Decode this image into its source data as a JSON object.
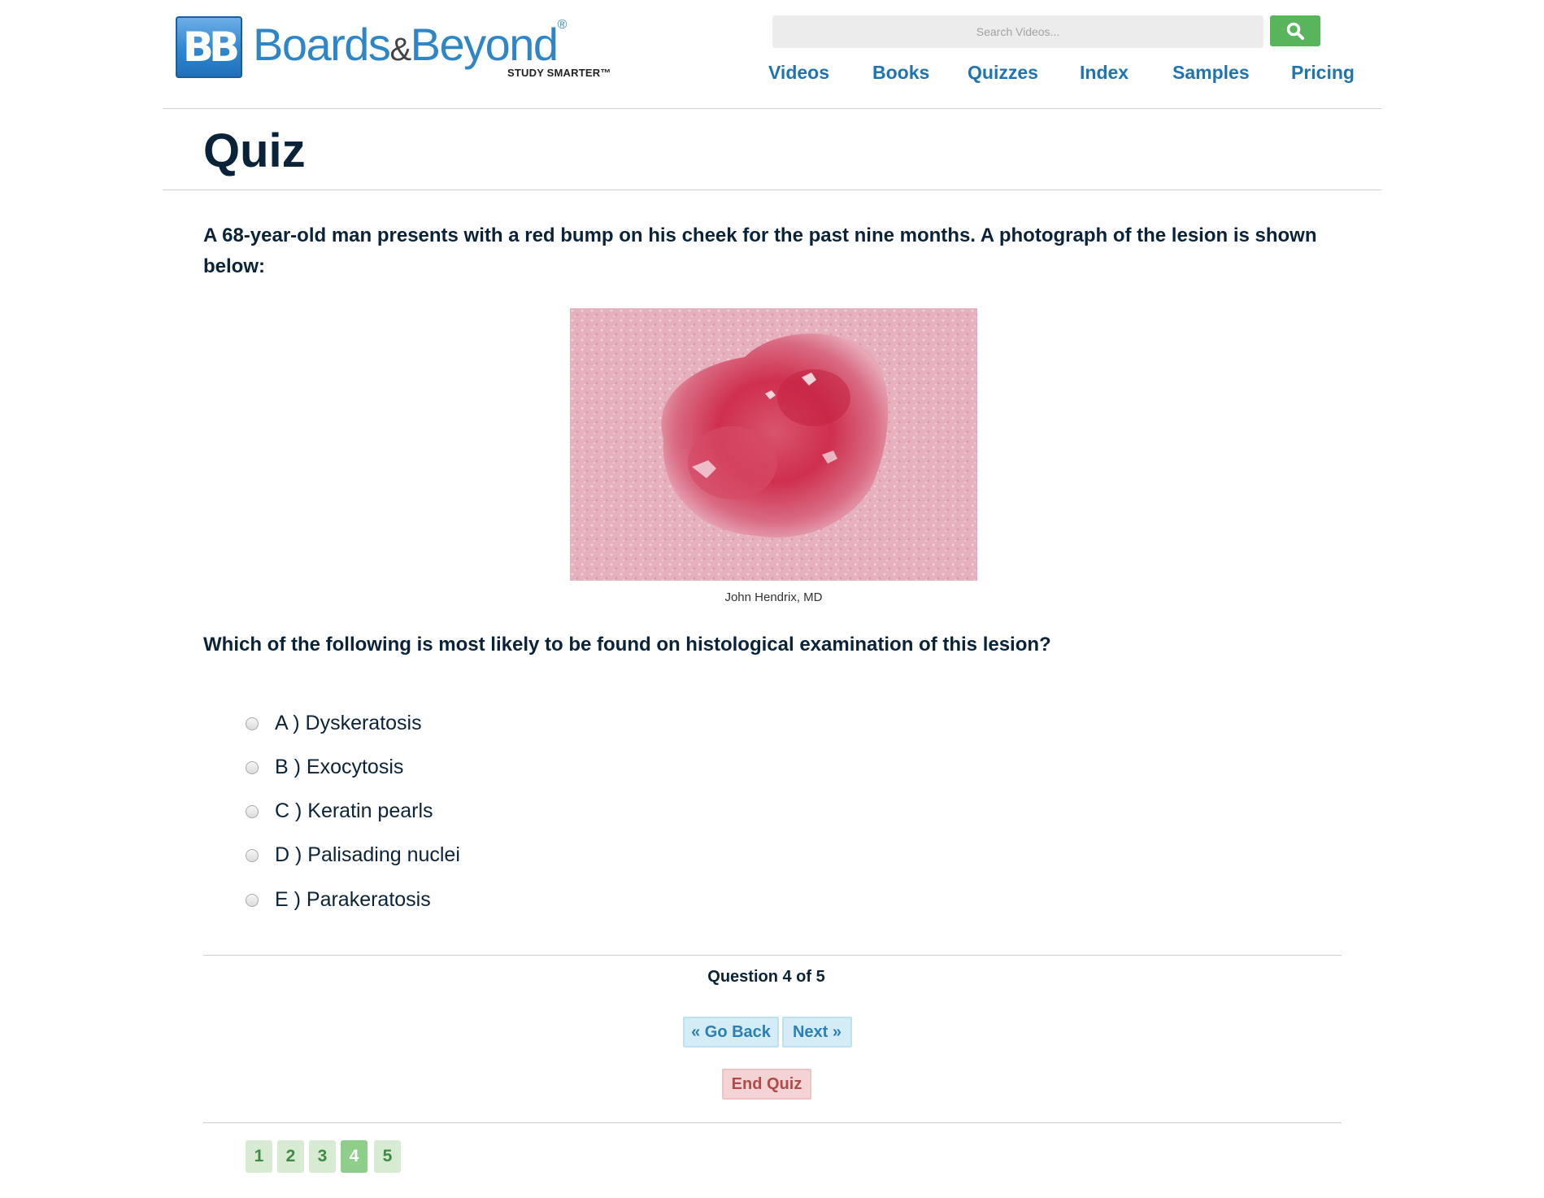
{
  "brand": {
    "badge": "BB",
    "name_part1": "Boards",
    "name_amp": "&",
    "name_part2": "Beyond",
    "registered": "®",
    "tagline": "STUDY SMARTER™"
  },
  "search": {
    "placeholder": "Search Videos...",
    "icon": "search-icon",
    "button_color": "#59b55c"
  },
  "nav": {
    "items": [
      "Videos",
      "Books",
      "Quizzes",
      "Index",
      "Samples",
      "Pricing"
    ]
  },
  "page": {
    "title": "Quiz"
  },
  "quiz": {
    "question": "A 68-year-old man presents with a red bump on his cheek for the past nine months. A photograph of the lesion is shown below:",
    "image_caption": "John Hendrix, MD",
    "prompt": "Which of the following is most likely to be found on histological examination of this lesion?",
    "options": [
      "A ) Dyskeratosis",
      "B ) Exocytosis",
      "C ) Keratin pearls",
      "D ) Palisading nuclei",
      "E ) Parakeratosis"
    ],
    "progress": "Question 4 of 5",
    "buttons": {
      "back": "« Go Back",
      "next": "Next »",
      "end": "End Quiz"
    },
    "pages": [
      "1",
      "2",
      "3",
      "4",
      "5"
    ],
    "current_page": "4"
  },
  "colors": {
    "title": "#0b2339",
    "nav_link": "#1f74b3",
    "nav_button": "#d4ecf6",
    "end_button": "#f3d3d3",
    "page_button": "#d6ebd2",
    "page_active": "#8fce8a"
  }
}
